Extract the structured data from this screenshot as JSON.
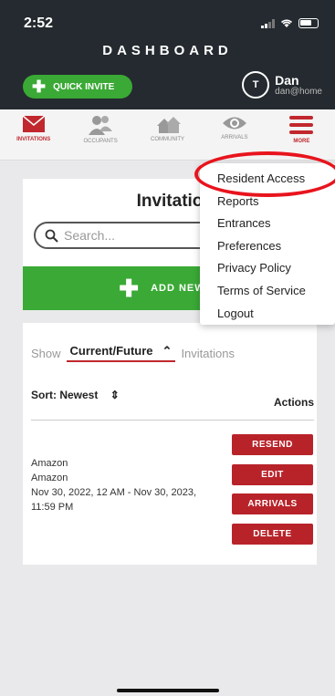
{
  "status": {
    "time": "2:52"
  },
  "header": {
    "title": "DASHBOARD",
    "quick_invite": "QUICK INVITE",
    "user": {
      "name": "Dan",
      "email": "dan@home",
      "avatar_initials": "T"
    }
  },
  "nav": [
    {
      "label": "INVITATIONS",
      "icon": "envelope-icon"
    },
    {
      "label": "OCCUPANTS",
      "icon": "people-icon"
    },
    {
      "label": "COMMUNITY",
      "icon": "houses-icon"
    },
    {
      "label": "ARRIVALS",
      "icon": "eye-icon"
    },
    {
      "label": "MORE",
      "icon": "hamburger-icon"
    }
  ],
  "main": {
    "title": "Invitatio",
    "search_placeholder": "Search...",
    "add_new": "ADD NEW IN"
  },
  "menu": {
    "items": [
      "Resident Access",
      "Reports",
      "Entrances",
      "Preferences",
      "Privacy Policy",
      "Terms of Service",
      "Logout"
    ]
  },
  "list": {
    "show": "Show",
    "filter": "Current/Future",
    "filter_suffix": "Invitations",
    "sort": "Sort: Newest",
    "actions": "Actions",
    "row": {
      "line1": "Amazon",
      "line2": "Amazon",
      "dates": "Nov 30, 2022, 12 AM - Nov 30, 2023, 11:59 PM"
    },
    "buttons": [
      "RESEND",
      "EDIT",
      "ARRIVALS",
      "DELETE"
    ]
  },
  "colors": {
    "accent_red": "#c0282d",
    "green": "#3aa935",
    "header_bg": "#242a2f"
  }
}
